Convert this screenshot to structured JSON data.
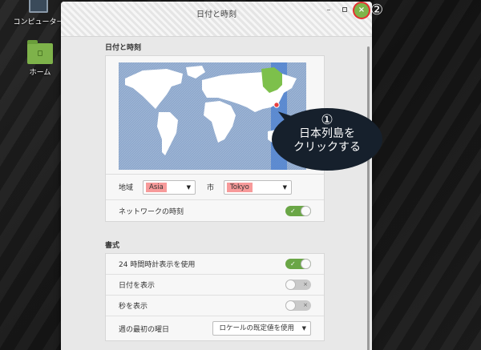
{
  "desktop": {
    "computer_label": "コンピューター",
    "home_label": "ホーム"
  },
  "window": {
    "title": "日付と時刻",
    "minimize_label": "–",
    "close_label": "×"
  },
  "datetime_section": {
    "title": "日付と時刻",
    "region_label": "地域",
    "region_value": "Asia",
    "city_label": "市",
    "city_value": "Tokyo",
    "network_time_label": "ネットワークの時刻",
    "network_time_on": true
  },
  "format_section": {
    "title": "書式",
    "use_24h_label": "24 時間時計表示を使用",
    "use_24h_on": true,
    "show_date_label": "日付を表示",
    "show_date_on": false,
    "show_seconds_label": "秒を表示",
    "show_seconds_on": false,
    "first_day_label": "週の最初の曜日",
    "first_day_value": "ロケールの既定値を使用"
  },
  "annotations": {
    "step1_number": "①",
    "step1_line1": "日本列島を",
    "step1_line2": "クリックする",
    "step2_number": "②"
  },
  "switch_marks": {
    "on": "✓",
    "off": "×"
  },
  "dropdown_arrow": "▼",
  "colors": {
    "map_ocean": "#8ea8cc",
    "map_land": "#ffffff",
    "timezone_band": "#4a7fd0",
    "selected_zone": "#7dc04b",
    "switch_on": "#6aa646",
    "close_button": "#7fb449",
    "highlight": "#f79a9a",
    "callout_bg": "#16202c",
    "close_circle": "#e53030"
  },
  "icons": [
    "monitor-icon",
    "home-folder-icon",
    "close-icon",
    "minimize-icon",
    "maximize-icon",
    "chevron-down-icon",
    "check-icon",
    "x-icon",
    "map-pin-icon"
  ]
}
